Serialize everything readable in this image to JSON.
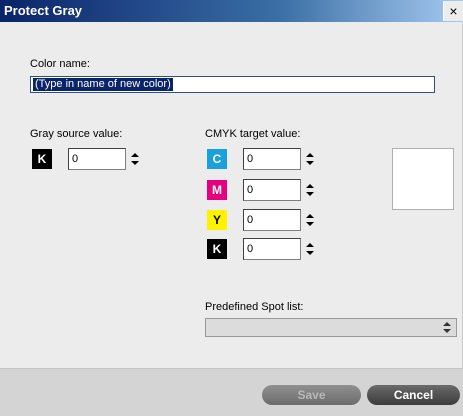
{
  "window": {
    "title": "Protect Gray",
    "close_glyph": "×"
  },
  "color_name": {
    "label": "Color name:",
    "value": "(Type in name of new color)"
  },
  "gray_source": {
    "label": "Gray source value:",
    "channel": {
      "letter": "K",
      "value": "0"
    }
  },
  "cmyk_target": {
    "label": "CMYK target value:",
    "channels": [
      {
        "letter": "C",
        "value": "0",
        "color": "#1aa1dc"
      },
      {
        "letter": "M",
        "value": "0",
        "color": "#e6007e"
      },
      {
        "letter": "Y",
        "value": "0",
        "color": "#fff200"
      },
      {
        "letter": "K",
        "value": "0",
        "color": "#000000"
      }
    ]
  },
  "spot_list": {
    "label": "Predefined Spot list:",
    "value": ""
  },
  "buttons": {
    "save": "Save",
    "cancel": "Cancel"
  }
}
